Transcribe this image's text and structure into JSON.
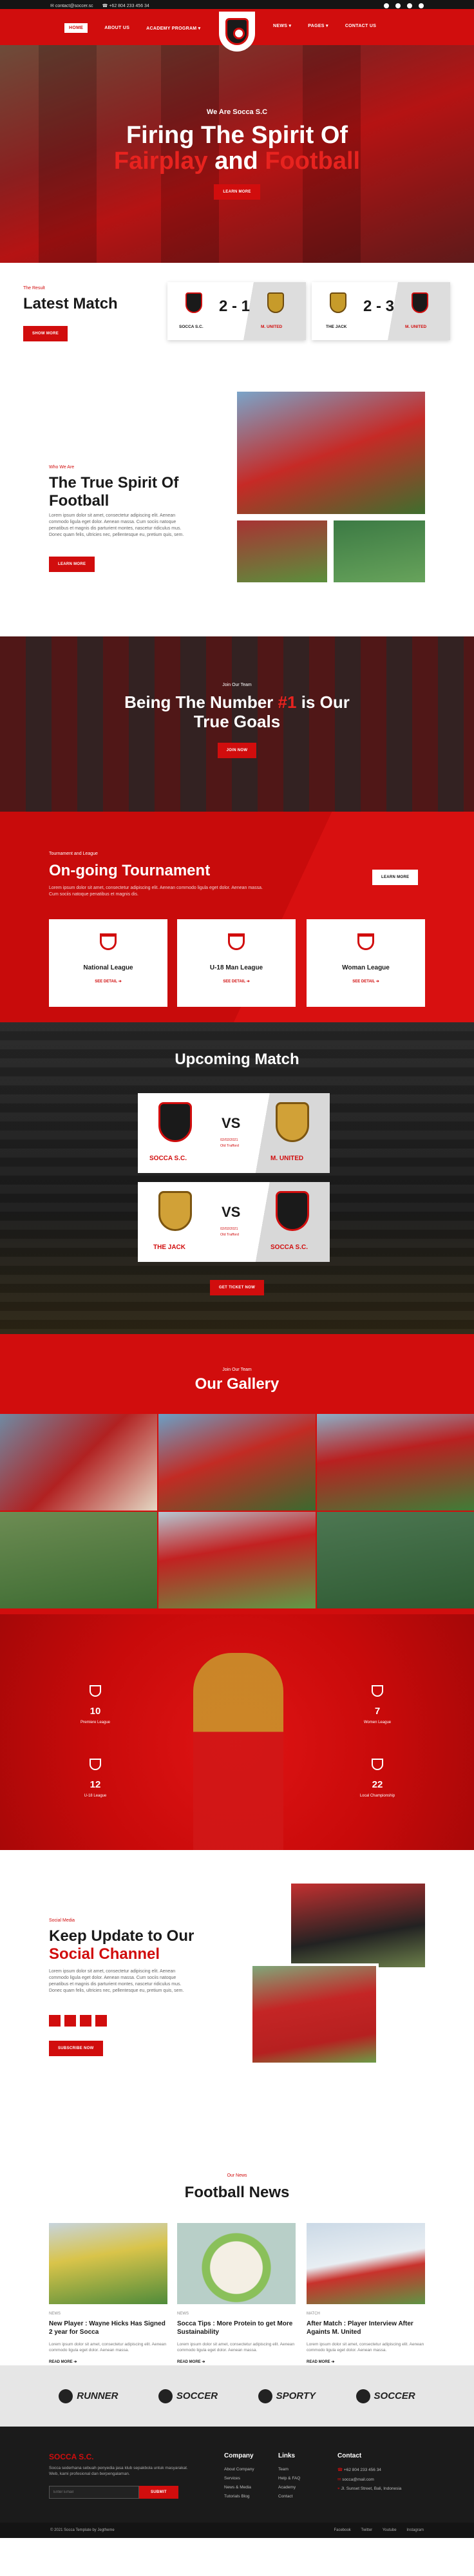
{
  "topbar": {
    "email": "contact@soccer.sc",
    "phone": "+62 804 233 456 34"
  },
  "nav": {
    "items": [
      "HOME",
      "ABOUT US",
      "ACADEMY PROGRAM ▾",
      "NEWS ▾",
      "PAGES ▾",
      "CONTACT US"
    ]
  },
  "hero": {
    "eyebrow": "We Are Socca S.C",
    "title_line1": "Firing The Spirit Of",
    "title_red1": "Fairplay",
    "title_and": "and",
    "title_red2": "Football",
    "button": "LEARN MORE"
  },
  "latest": {
    "eyebrow": "The Result",
    "title": "Latest Match",
    "button": "SHOW MORE",
    "matches": [
      {
        "home": "SOCCA S.C.",
        "away": "M. UNITED",
        "score": "2 - 1"
      },
      {
        "home": "THE JACK",
        "away": "M. UNITED",
        "score": "2 - 3"
      }
    ]
  },
  "spirit": {
    "eyebrow": "Who We Are",
    "title": "The True Spirit Of Football",
    "text": "Lorem ipsum dolor sit amet, consectetur adipiscing elit. Aenean commodo ligula eget dolor. Aenean massa. Cum sociis natoque penatibus et magnis dis parturient montes, nascetur ridiculus mus. Donec quam felis, ultricies nec, pellentesque eu, pretium quis, sem.",
    "button": "LEARN MORE"
  },
  "numone": {
    "eyebrow": "Join Our Team",
    "title_a": "Being The Number",
    "title_red": "#1",
    "title_b": "is Our",
    "title_c": "True Goals",
    "button": "JOIN NOW"
  },
  "tournament": {
    "eyebrow": "Tournament and League",
    "title": "On-going Tournament",
    "text": "Lorem ipsum dolor sit amet, consectetur adipiscing elit. Aenean commodo ligula eget dolor. Aenean massa. Cum sociis natoque penatibus et magnis dis.",
    "button": "LEARN MORE",
    "cards": [
      {
        "name": "National League",
        "link": "SEE DETAIL ➔"
      },
      {
        "name": "U-18 Man League",
        "link": "SEE DETAIL ➔"
      },
      {
        "name": "Woman League",
        "link": "SEE DETAIL ➔"
      }
    ]
  },
  "upcoming": {
    "title": "Upcoming Match",
    "button": "GET TICKET NOW",
    "matches": [
      {
        "home": "SOCCA S.C.",
        "away": "M. UNITED",
        "vs": "VS",
        "date": "02/02/2021",
        "venue": "Old Trafford"
      },
      {
        "home": "THE JACK",
        "away": "SOCCA S.C.",
        "vs": "VS",
        "date": "02/02/2021",
        "venue": "Old Trafford"
      }
    ]
  },
  "gallery": {
    "eyebrow": "Join Our Team",
    "title": "Our Gallery"
  },
  "stats": [
    {
      "num": "10",
      "label": "Premiere League"
    },
    {
      "num": "7",
      "label": "Women League"
    },
    {
      "num": "12",
      "label": "U-18 League"
    },
    {
      "num": "22",
      "label": "Local Championship"
    }
  ],
  "social": {
    "eyebrow": "Social Media",
    "title_a": "Keep Update to Our",
    "title_red": "Social Channel",
    "text": "Lorem ipsum dolor sit amet, consectetur adipiscing elit. Aenean commodo ligula eget dolor. Aenean massa. Cum sociis natoque penatibus et magnis dis parturient montes, nascetur ridiculus mus. Donec quam felis, ultricies nec, pellentesque eu, pretium quis, sem.",
    "button": "SUBSCRIBE NOW"
  },
  "news": {
    "eyebrow": "Our News",
    "title": "Football News",
    "read": "READ MORE ➔",
    "items": [
      {
        "tag": "NEWS",
        "title": "New Player : Wayne Hicks Has Signed 2 year for Socca",
        "text": "Lorem ipsum dolor sit amet, consectetur adipiscing elit. Aenean commodo ligula eget dolor. Aenean massa."
      },
      {
        "tag": "NEWS",
        "title": "Socca Tips : More Protein to get More Sustainability",
        "text": "Lorem ipsum dolor sit amet, consectetur adipiscing elit. Aenean commodo ligula eget dolor. Aenean massa."
      },
      {
        "tag": "MATCH",
        "title": "After Match : Player Interview After Againts M. United",
        "text": "Lorem ipsum dolor sit amet, consectetur adipiscing elit. Aenean commodo ligula eget dolor. Aenean massa."
      }
    ]
  },
  "partners": [
    "RUNNER",
    "SOCCER",
    "SPORTY",
    "SOCCER"
  ],
  "footer": {
    "brand": "SOCCA S.C.",
    "about": "Socca sederhana sebuah penyedia jasa klub sepakbola untuk masyarakat. Web, kami profesional dan berpengalaman.",
    "email_placeholder": "Enter Email",
    "submit": "SUBMIT",
    "company_title": "Company",
    "company": [
      "About Company",
      "Services",
      "News & Media",
      "Tutorials Blog"
    ],
    "links_title": "Links",
    "links": [
      "Team",
      "Help & FAQ",
      "Academy",
      "Contact"
    ],
    "contact_title": "Contact",
    "contact": [
      "+62 804 233 456 34",
      "socca@mail.com",
      "Jl. Sunset Street, Bali, Indonesia"
    ],
    "copyright": "© 2021 Socca Template by Jegtheme",
    "bottom_links": [
      "Facebook",
      "Twitter",
      "Youtube",
      "Instagram"
    ]
  }
}
